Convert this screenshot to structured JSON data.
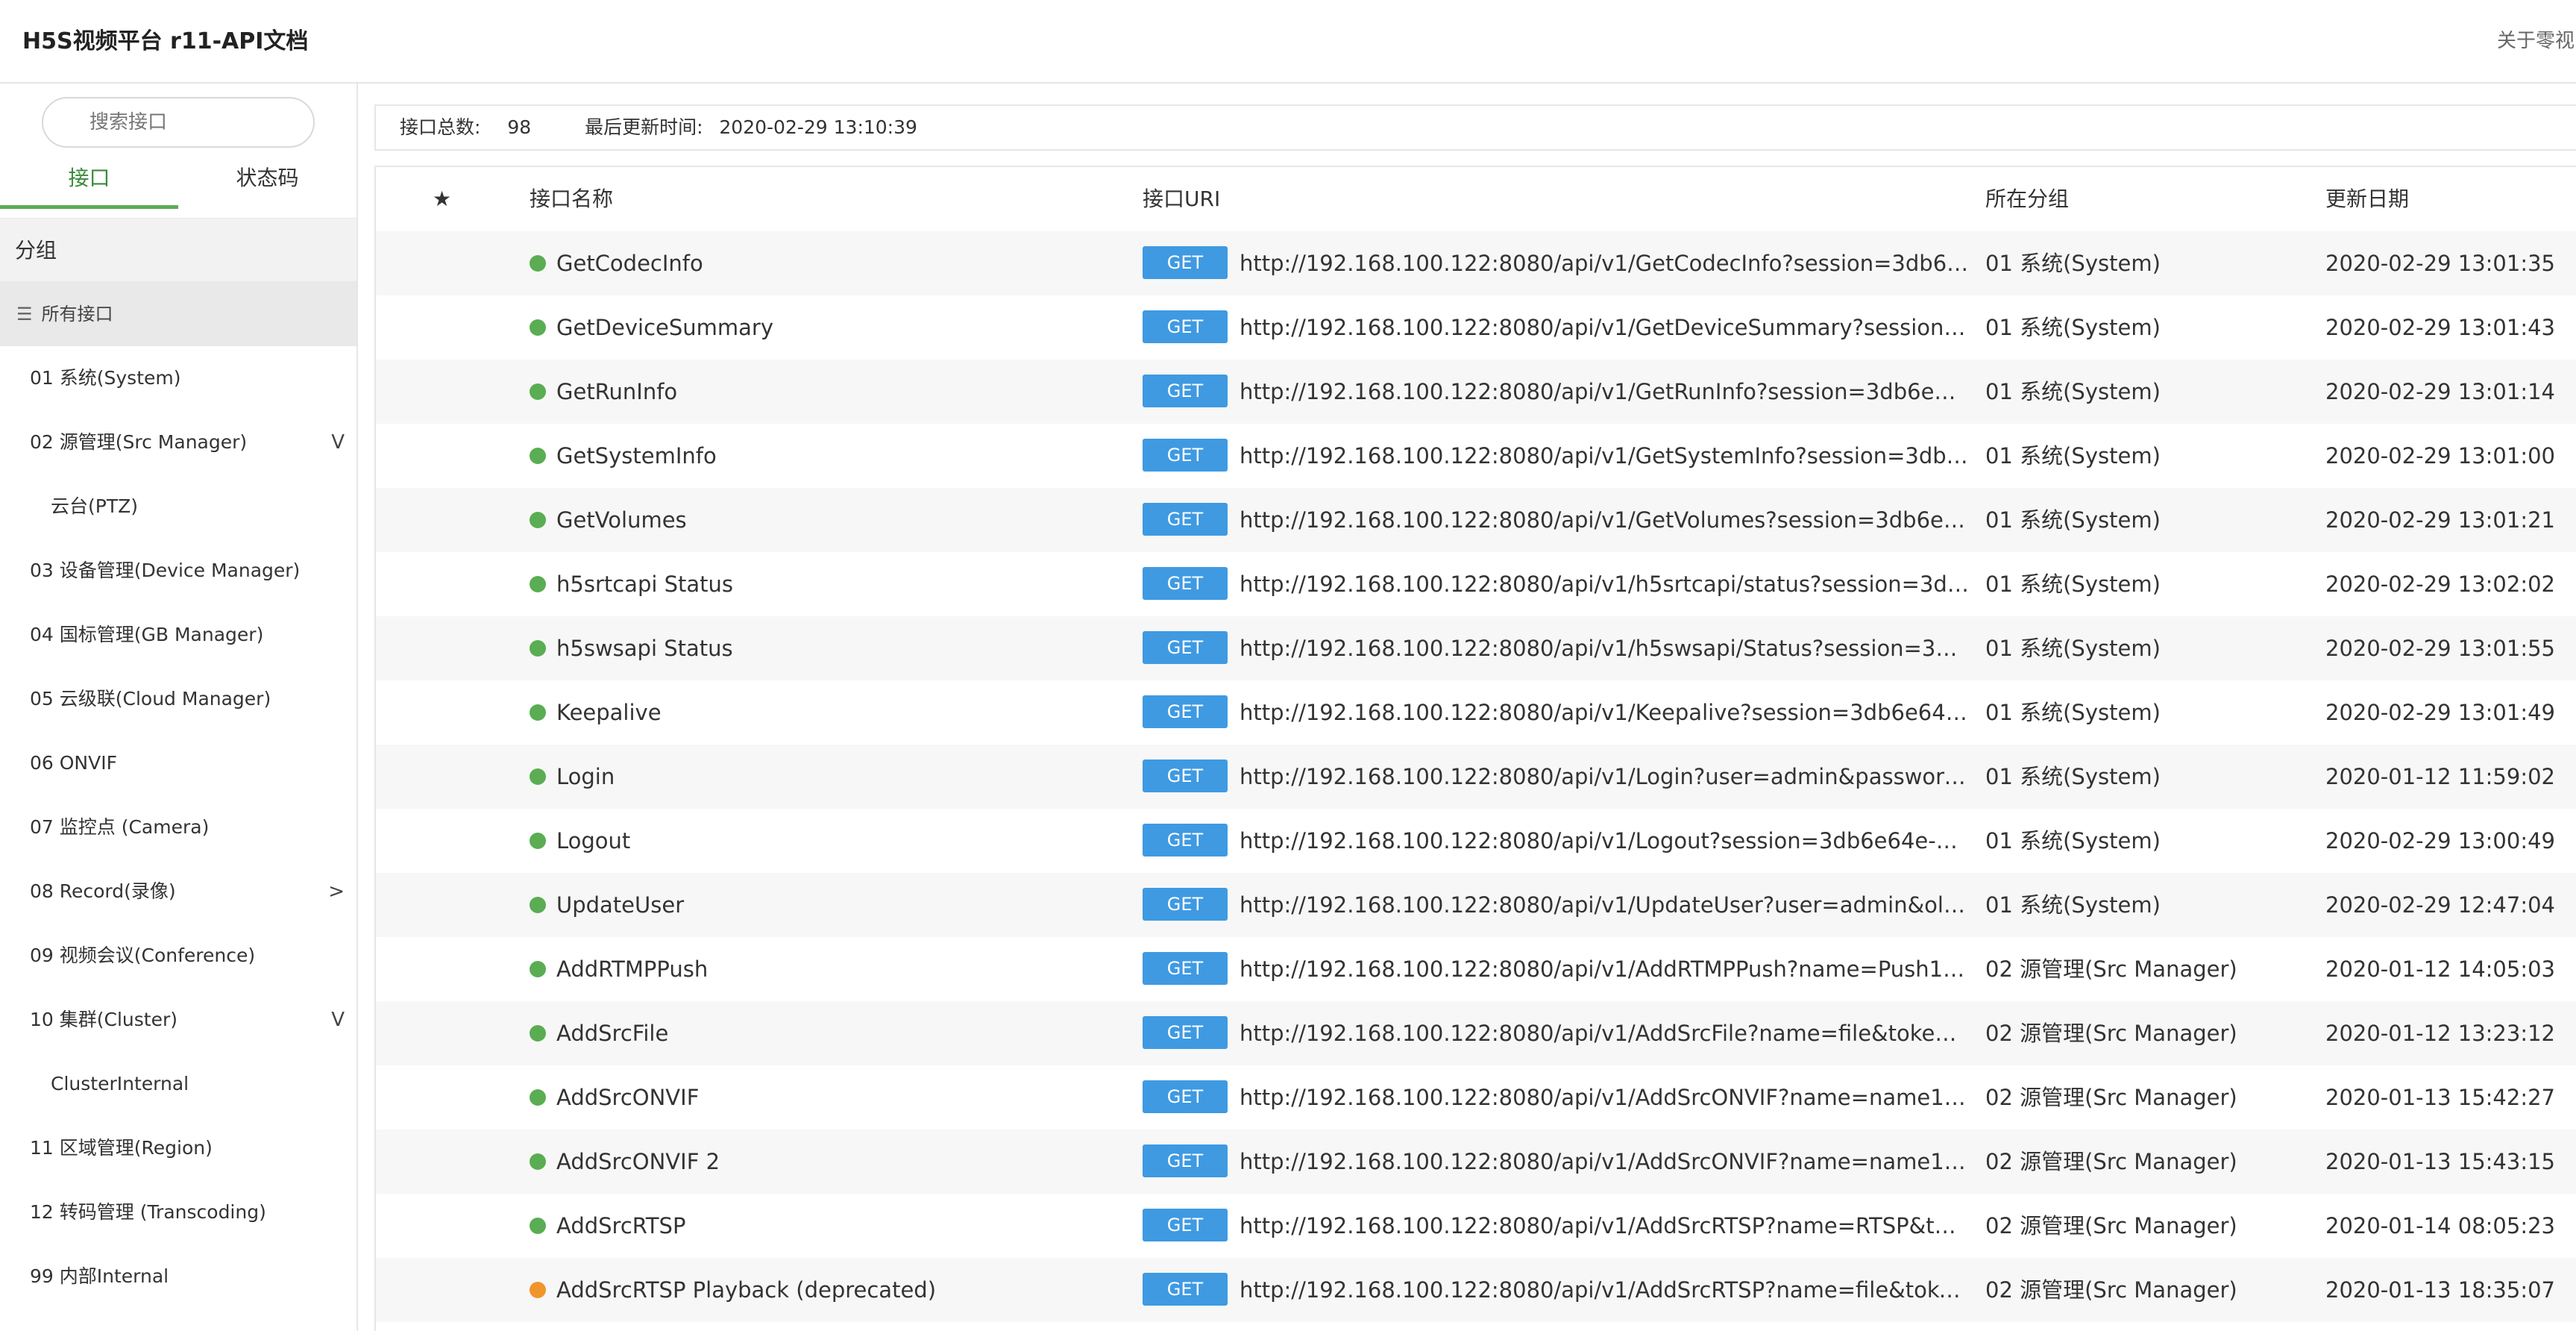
{
  "header": {
    "title": "H5S视频平台 r11-API文档",
    "about": "关于零视"
  },
  "sidebar": {
    "search_placeholder": "搜索接口",
    "tabs": [
      {
        "label": "接口",
        "active": true
      },
      {
        "label": "状态码",
        "active": false
      }
    ],
    "group_header": "分组",
    "all_label": "所有接口",
    "groups": [
      {
        "label": "01 系统(System)",
        "sub": false,
        "chevron": ""
      },
      {
        "label": "02 源管理(Src Manager)",
        "sub": false,
        "chevron": "V"
      },
      {
        "label": "云台(PTZ)",
        "sub": true,
        "chevron": ""
      },
      {
        "label": "03 设备管理(Device Manager)",
        "sub": false,
        "chevron": ""
      },
      {
        "label": "04 国标管理(GB Manager)",
        "sub": false,
        "chevron": ""
      },
      {
        "label": "05 云级联(Cloud Manager)",
        "sub": false,
        "chevron": ""
      },
      {
        "label": "06 ONVIF",
        "sub": false,
        "chevron": ""
      },
      {
        "label": "07 监控点 (Camera)",
        "sub": false,
        "chevron": ""
      },
      {
        "label": "08 Record(录像)",
        "sub": false,
        "chevron": ">"
      },
      {
        "label": "09 视频会议(Conference)",
        "sub": false,
        "chevron": ""
      },
      {
        "label": "10 集群(Cluster)",
        "sub": false,
        "chevron": "V"
      },
      {
        "label": "ClusterInternal",
        "sub": true,
        "chevron": ""
      },
      {
        "label": "11 区域管理(Region)",
        "sub": false,
        "chevron": ""
      },
      {
        "label": "12 转码管理 (Transcoding)",
        "sub": false,
        "chevron": ""
      },
      {
        "label": "99 内部Internal",
        "sub": false,
        "chevron": ""
      }
    ]
  },
  "info": {
    "total_label": "接口总数:",
    "total_value": "98",
    "updated_label": "最后更新时间:",
    "updated_value": "2020-02-29 13:10:39"
  },
  "table": {
    "columns": {
      "star": "★",
      "name": "接口名称",
      "uri": "接口URI",
      "group": "所在分组",
      "date": "更新日期"
    },
    "status_colors": {
      "ok": "#5aad52",
      "deprecated": "#f0952a"
    },
    "method_color": "#3f9ae2",
    "rows": [
      {
        "name": "GetCodecInfo",
        "status": "ok",
        "method": "GET",
        "uri": "http://192.168.100.122:8080/api/v1/GetCodecInfo?session=3db6e…",
        "group": "01 系统(System)",
        "date": "2020-02-29 13:01:35"
      },
      {
        "name": "GetDeviceSummary",
        "status": "ok",
        "method": "GET",
        "uri": "http://192.168.100.122:8080/api/v1/GetDeviceSummary?session=…",
        "group": "01 系统(System)",
        "date": "2020-02-29 13:01:43"
      },
      {
        "name": "GetRunInfo",
        "status": "ok",
        "method": "GET",
        "uri": "http://192.168.100.122:8080/api/v1/GetRunInfo?session=3db6e64…",
        "group": "01 系统(System)",
        "date": "2020-02-29 13:01:14"
      },
      {
        "name": "GetSystemInfo",
        "status": "ok",
        "method": "GET",
        "uri": "http://192.168.100.122:8080/api/v1/GetSystemInfo?session=3db6…",
        "group": "01 系统(System)",
        "date": "2020-02-29 13:01:00"
      },
      {
        "name": "GetVolumes",
        "status": "ok",
        "method": "GET",
        "uri": "http://192.168.100.122:8080/api/v1/GetVolumes?session=3db6e6…",
        "group": "01 系统(System)",
        "date": "2020-02-29 13:01:21"
      },
      {
        "name": "h5srtcapi Status",
        "status": "ok",
        "method": "GET",
        "uri": "http://192.168.100.122:8080/api/v1/h5srtcapi/status?session=3db…",
        "group": "01 系统(System)",
        "date": "2020-02-29 13:02:02"
      },
      {
        "name": "h5swsapi Status",
        "status": "ok",
        "method": "GET",
        "uri": "http://192.168.100.122:8080/api/v1/h5swsapi/Status?session=3db…",
        "group": "01 系统(System)",
        "date": "2020-02-29 13:01:55"
      },
      {
        "name": "Keepalive",
        "status": "ok",
        "method": "GET",
        "uri": "http://192.168.100.122:8080/api/v1/Keepalive?session=3db6e64e-…",
        "group": "01 系统(System)",
        "date": "2020-02-29 13:01:49"
      },
      {
        "name": "Login",
        "status": "ok",
        "method": "GET",
        "uri": "http://192.168.100.122:8080/api/v1/Login?user=admin&password…",
        "group": "01 系统(System)",
        "date": "2020-01-12 11:59:02"
      },
      {
        "name": "Logout",
        "status": "ok",
        "method": "GET",
        "uri": "http://192.168.100.122:8080/api/v1/Logout?session=3db6e64e-eb…",
        "group": "01 系统(System)",
        "date": "2020-02-29 13:00:49"
      },
      {
        "name": "UpdateUser",
        "status": "ok",
        "method": "GET",
        "uri": "http://192.168.100.122:8080/api/v1/UpdateUser?user=admin&old…",
        "group": "01 系统(System)",
        "date": "2020-02-29 12:47:04"
      },
      {
        "name": "AddRTMPPush",
        "status": "ok",
        "method": "GET",
        "uri": "http://192.168.100.122:8080/api/v1/AddRTMPPush?name=Push1…",
        "group": "02 源管理(Src Manager)",
        "date": "2020-01-12 14:05:03"
      },
      {
        "name": "AddSrcFile",
        "status": "ok",
        "method": "GET",
        "uri": "http://192.168.100.122:8080/api/v1/AddSrcFile?name=file&token=…",
        "group": "02 源管理(Src Manager)",
        "date": "2020-01-12 13:23:12"
      },
      {
        "name": "AddSrcONVIF",
        "status": "ok",
        "method": "GET",
        "uri": "http://192.168.100.122:8080/api/v1/AddSrcONVIF?name=name1&…",
        "group": "02 源管理(Src Manager)",
        "date": "2020-01-13 15:42:27"
      },
      {
        "name": "AddSrcONVIF 2",
        "status": "ok",
        "method": "GET",
        "uri": "http://192.168.100.122:8080/api/v1/AddSrcONVIF?name=name1&…",
        "group": "02 源管理(Src Manager)",
        "date": "2020-01-13 15:43:15"
      },
      {
        "name": "AddSrcRTSP",
        "status": "ok",
        "method": "GET",
        "uri": "http://192.168.100.122:8080/api/v1/AddSrcRTSP?name=RTSP&to…",
        "group": "02 源管理(Src Manager)",
        "date": "2020-01-14 08:05:23"
      },
      {
        "name": "AddSrcRTSP Playback (deprecated)",
        "status": "deprecated",
        "method": "GET",
        "uri": "http://192.168.100.122:8080/api/v1/AddSrcRTSP?name=file&toke…",
        "group": "02 源管理(Src Manager)",
        "date": "2020-01-13 18:35:07"
      }
    ]
  }
}
